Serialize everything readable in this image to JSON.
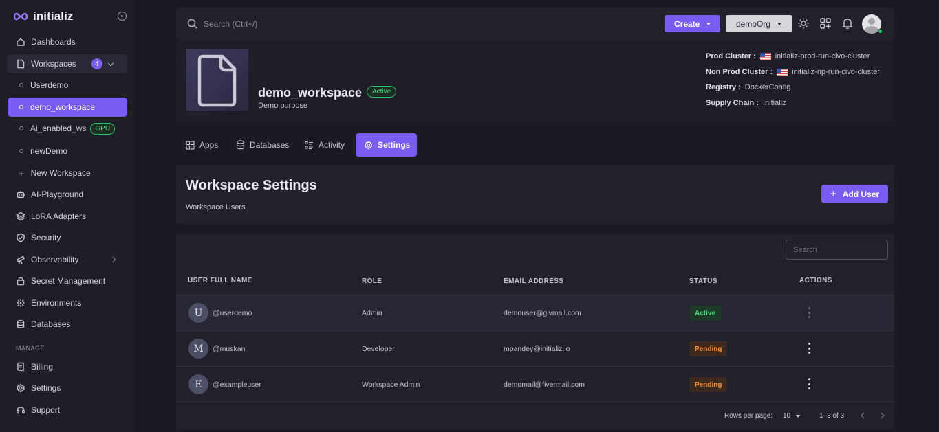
{
  "brand": {
    "name": "initializ"
  },
  "sidebar": {
    "items": [
      {
        "label": "Dashboards"
      },
      {
        "label": "Workspaces",
        "badge": "4"
      },
      {
        "label": "Userdemo"
      },
      {
        "label": "demo_workspace"
      },
      {
        "label": "Ai_enabled_ws",
        "tag": "GPU"
      },
      {
        "label": "newDemo"
      },
      {
        "label": "New Workspace"
      },
      {
        "label": "AI-Playground"
      },
      {
        "label": "LoRA Adapters"
      },
      {
        "label": "Security"
      },
      {
        "label": "Observability"
      },
      {
        "label": "Secret Management"
      },
      {
        "label": "Environments"
      },
      {
        "label": "Databases"
      }
    ],
    "manage_label": "MANAGE",
    "manage_items": [
      {
        "label": "Billing"
      },
      {
        "label": "Settings"
      },
      {
        "label": "Support"
      }
    ]
  },
  "topbar": {
    "search_placeholder": "Search (Ctrl+/)",
    "create_label": "Create",
    "org_label": "demoOrg"
  },
  "workspace": {
    "name": "demo_workspace",
    "status": "Active",
    "description": "Demo purpose",
    "meta": [
      {
        "key": "Prod Cluster :",
        "value": "initializ-prod-run-civo-cluster",
        "flag": true
      },
      {
        "key": "Non Prod Cluster :",
        "value": "initializ-np-run-civo-cluster",
        "flag": true
      },
      {
        "key": "Registry :",
        "value": "DockerConfig",
        "flag": false
      },
      {
        "key": "Supply Chain :",
        "value": "Initializ",
        "flag": false
      }
    ]
  },
  "tabs": [
    {
      "label": "Apps"
    },
    {
      "label": "Databases"
    },
    {
      "label": "Activity"
    },
    {
      "label": "Settings",
      "active": true
    }
  ],
  "settings": {
    "title": "Workspace Settings",
    "subtitle": "Workspace Users",
    "add_user_label": "Add User"
  },
  "users_table": {
    "search_placeholder": "Search",
    "columns": [
      "USER FULL NAME",
      "ROLE",
      "EMAIL ADDRESS",
      "STATUS",
      "ACTIONS"
    ],
    "rows": [
      {
        "initial": "U",
        "username": "@userdemo",
        "role": "Admin",
        "email": "demouser@givmail.com",
        "status": "Active"
      },
      {
        "initial": "M",
        "username": "@muskan",
        "role": "Developer",
        "email": "mpandey@initializ.io",
        "status": "Pending"
      },
      {
        "initial": "E",
        "username": "@exampleuser",
        "role": "Workspace Admin",
        "email": "demomail@fivermail.com",
        "status": "Pending"
      }
    ],
    "pagination": {
      "rows_per_page_label": "Rows per page:",
      "rows_per_page": "10",
      "range": "1–3 of 3"
    }
  },
  "colors": {
    "accent": "#7a5cf0",
    "active_status": "#4ade80",
    "pending_status": "#fb923c"
  }
}
